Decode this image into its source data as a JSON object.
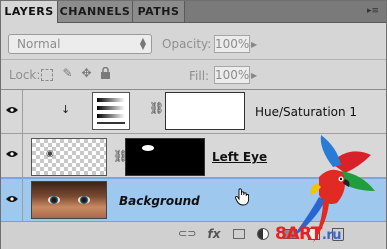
{
  "tabs": [
    {
      "label": "LAYERS",
      "active": true
    },
    {
      "label": "CHANNELS",
      "active": false
    },
    {
      "label": "PATHS",
      "active": false
    }
  ],
  "panel_menu_icon": "double-chevron-menu-icon",
  "blend": {
    "value": "Normal"
  },
  "opacity": {
    "label": "Opacity:",
    "value": "100%"
  },
  "lock": {
    "label": "Lock:",
    "icons": [
      "lock-transparent-icon",
      "lock-brush-icon",
      "lock-move-icon",
      "lock-all-icon"
    ]
  },
  "fill": {
    "label": "Fill:",
    "value": "100%"
  },
  "layers": [
    {
      "name": "Hue/Saturation 1",
      "visible": true,
      "type": "adjustment",
      "clipped": true
    },
    {
      "name": "Left Eye",
      "visible": true,
      "type": "pixel",
      "has_mask": true
    },
    {
      "name": "Background",
      "visible": true,
      "type": "pixel",
      "selected": true
    }
  ],
  "bottom_icons": [
    "link-layers-icon",
    "fx-icon",
    "add-mask-icon",
    "adjustment-icon",
    "group-icon",
    "new-layer-icon",
    "delete-icon"
  ],
  "bottom_text": {
    "fx": "fx"
  },
  "watermark": {
    "text": "8ART",
    "suffix": ".ru"
  },
  "colors": {
    "selected_row": "#9fc8ef",
    "panel": "#d6d6d6",
    "tab_bar": "#7a7a7a",
    "watermark_red": "#e8231f",
    "watermark_blue": "#3a66c8"
  }
}
